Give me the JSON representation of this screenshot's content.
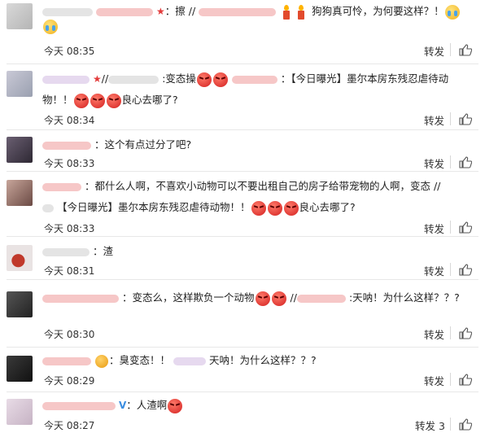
{
  "colors": {
    "accent_red": "#e23b3b",
    "verified_blue": "#3b8de0",
    "divider": "#e8e8e8"
  },
  "share_label": "转发",
  "comments": [
    {
      "pre": "：擦 //",
      "post": "狗狗真可怜，为何要这样？！",
      "time": "今天 08:35",
      "share": "转发"
    },
    {
      "pre": "//",
      "mid": ":变态操",
      "text1": "：【今日曝光】墨尔本房东残忍虐待动",
      "line2a": "物！！",
      "line2b": "良心去哪了?",
      "time": "今天 08:34",
      "share": "转发"
    },
    {
      "text": "：这个有点过分了吧?",
      "time": "今天 08:33",
      "share": "转发"
    },
    {
      "text": "：都什么人啊，不喜欢小动物可以不要出租自己的房子给带宠物的人啊，变态 //",
      "line2a": "【今日曝光】墨尔本房东残忍虐待动物！！",
      "line2b": "良心去哪了?",
      "time": "今天 08:33",
      "share": "转发"
    },
    {
      "text": "：渣",
      "time": "今天 08:31",
      "share": "转发"
    },
    {
      "text": "：变态么，这样欺负一个动物",
      "mid": "//",
      "tail": ":天呐！为什么这样？？?",
      "time": "今天 08:30",
      "share": "转发"
    },
    {
      "text": "：臭变态！！",
      "tail": "天呐！为什么这样？？?",
      "time": "今天 08:29",
      "share": "转发"
    },
    {
      "text": "：人渣啊",
      "time": "今天 08:27",
      "share": "转发 3"
    }
  ]
}
